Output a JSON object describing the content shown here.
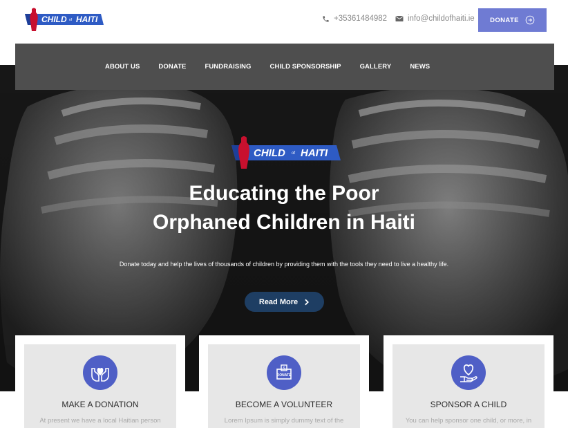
{
  "header": {
    "logo_text": "CHILD of HAITI",
    "phone": "+35361484982",
    "email": "info@childofhaiti.ie",
    "donate_label": "DONATE"
  },
  "nav": {
    "items": [
      {
        "label": "ABOUT US"
      },
      {
        "label": "DONATE"
      },
      {
        "label": "FUNDRAISING"
      },
      {
        "label": "CHILD SPONSORSHIP"
      },
      {
        "label": "GALLERY"
      },
      {
        "label": "NEWS"
      }
    ]
  },
  "hero": {
    "logo_text": "CHILD of HAITI",
    "title_line1": "Educating the Poor",
    "title_line2": "Orphaned Children in Haiti",
    "subtitle": "Donate today and help the lives of thousands of children by providing them with the tools they need to live a healthy life.",
    "cta_label": "Read More"
  },
  "cards": [
    {
      "title": "MAKE A DONATION",
      "text": "At present we have a local Haitian person",
      "icon": "heart-hands-icon"
    },
    {
      "title": "BECOME A VOLUNTEER",
      "text": "Lorem Ipsum is simply dummy text of the",
      "icon": "donate-box-icon"
    },
    {
      "title": "SPONSOR A CHILD",
      "text": "You can help sponsor one child, or more, in",
      "icon": "heart-hand-icon"
    }
  ],
  "colors": {
    "accent": "#6f7bd3",
    "nav_bg": "#4e4e4e",
    "cta_bg": "#1e3e63",
    "icon_bg": "#4f5fc6"
  }
}
